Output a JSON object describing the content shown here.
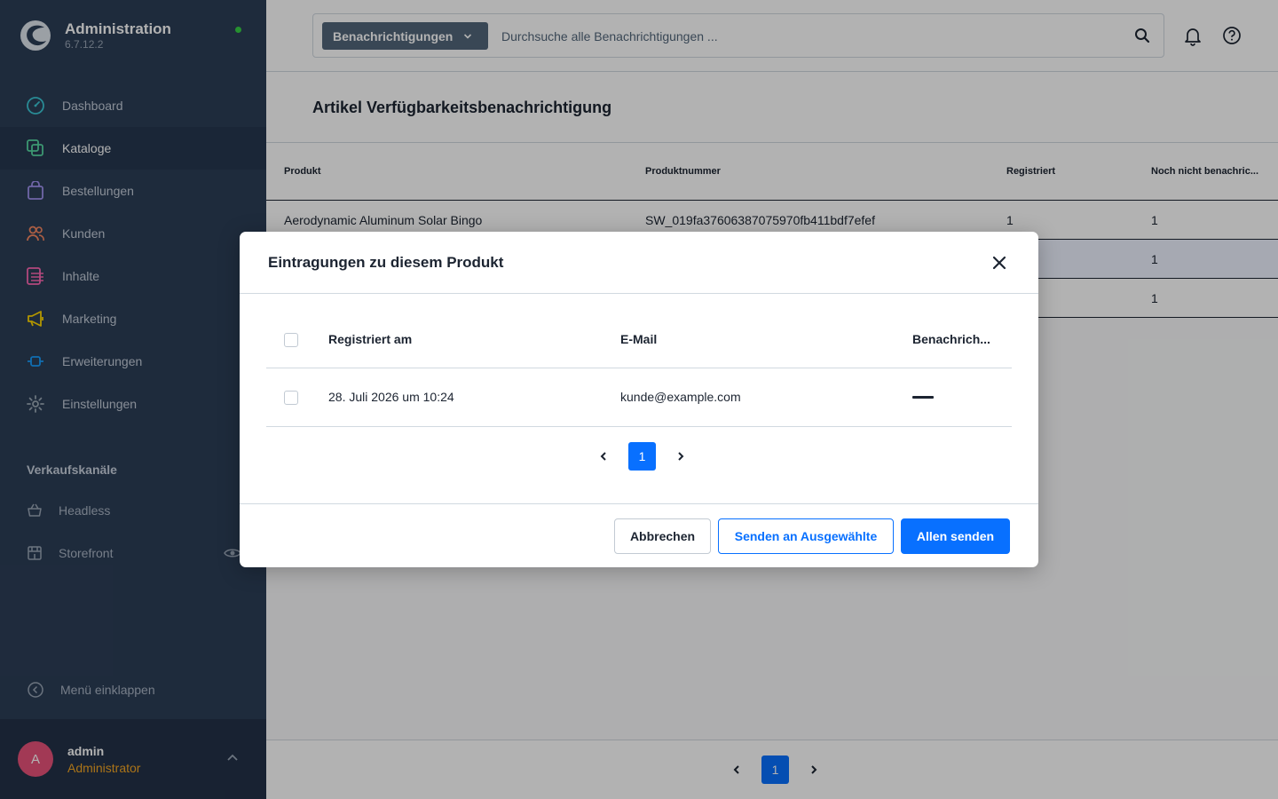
{
  "app": {
    "title": "Administration",
    "version": "6.7.12.2"
  },
  "sidebar": {
    "items": [
      {
        "label": "Dashboard",
        "icon": "gauge-icon",
        "color": "#3cc7d6"
      },
      {
        "label": "Kataloge",
        "icon": "catalog-icon",
        "color": "#57d9a3"
      },
      {
        "label": "Bestellungen",
        "icon": "shopping-bag-icon",
        "color": "#a092f0"
      },
      {
        "label": "Kunden",
        "icon": "users-icon",
        "color": "#f88962"
      },
      {
        "label": "Inhalte",
        "icon": "content-icon",
        "color": "#ff68b4"
      },
      {
        "label": "Marketing",
        "icon": "megaphone-icon",
        "color": "#ffd700"
      },
      {
        "label": "Erweiterungen",
        "icon": "plug-icon",
        "color": "#189eff"
      },
      {
        "label": "Einstellungen",
        "icon": "gear-icon",
        "color": "#9aa8b5"
      }
    ],
    "sales_channels_title": "Verkaufskanäle",
    "sales_channels": [
      {
        "label": "Headless",
        "icon": "basket-icon"
      },
      {
        "label": "Storefront",
        "icon": "storefront-icon"
      }
    ],
    "collapse_label": "Menü einklappen",
    "user": {
      "initial": "A",
      "name": "admin",
      "role": "Administrator"
    }
  },
  "search": {
    "type_label": "Benachrichtigungen",
    "placeholder": "Durchsuche alle Benachrichtigungen ..."
  },
  "page": {
    "title": "Artikel Verfügbarkeitsbenachrichtigung"
  },
  "grid": {
    "columns": [
      "Produkt",
      "Produktnummer",
      "Registriert",
      "Noch nicht benachric..."
    ],
    "rows": [
      {
        "product": "Aerodynamic Aluminum Solar Bingo",
        "number": "SW_019fa37606387075970fb411bdf7efef",
        "registered": "1",
        "not_notified": "1"
      },
      {
        "product": "",
        "number": "",
        "registered": "",
        "not_notified": "1"
      },
      {
        "product": "",
        "number": "",
        "registered": "",
        "not_notified": "1"
      }
    ],
    "current_page": "1"
  },
  "modal": {
    "title": "Eintragungen zu diesem Produkt",
    "columns": [
      "Registriert am",
      "E-Mail",
      "Benachrich..."
    ],
    "rows": [
      {
        "registered_at": "28. Juli 2026 um 10:24",
        "email": "kunde@example.com"
      }
    ],
    "current_page": "1",
    "buttons": {
      "cancel": "Abbrechen",
      "send_selected": "Senden an Ausgewählte",
      "send_all": "Allen senden"
    }
  },
  "colors": {
    "primary": "#0870ff",
    "sidebar": "#2c3e57",
    "status_online": "#37d046",
    "avatar": "#e8527a",
    "role": "#f5a623"
  }
}
